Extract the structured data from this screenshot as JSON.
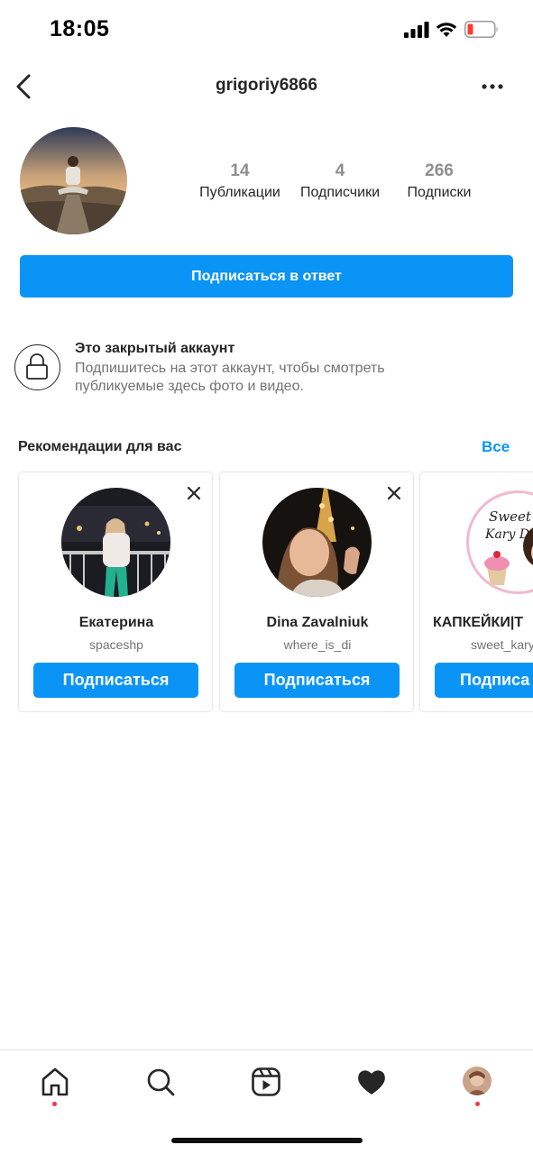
{
  "status_bar": {
    "time": "18:05"
  },
  "header": {
    "username": "grigoriy6866"
  },
  "profile": {
    "stats": [
      {
        "value": "14",
        "label": "Публикации"
      },
      {
        "value": "4",
        "label": "Подписчики"
      },
      {
        "value": "266",
        "label": "Подписки"
      }
    ],
    "follow_back_label": "Подписаться в ответ"
  },
  "private_account": {
    "title": "Это закрытый аккаунт",
    "description": "Подпишитесь на этот аккаунт, чтобы смотреть публикуемые здесь фото и видео."
  },
  "recommendations": {
    "title": "Рекомендации для вас",
    "see_all": "Все",
    "cards": [
      {
        "name": "Екатерина",
        "handle": "spaceshp",
        "button": "Подписаться"
      },
      {
        "name": "Dina Zavalniuk",
        "handle": "where_is_di",
        "button": "Подписаться"
      },
      {
        "name": "КАПКЕЙКИ|Т",
        "handle": "sweet_kary",
        "button": "Подписа",
        "logo_text": "Sweet Kary D."
      }
    ]
  },
  "nav": {
    "items": [
      "home-icon",
      "search-icon",
      "reels-icon",
      "activity-heart-icon",
      "profile-avatar"
    ],
    "accent_color": "#0a95f6",
    "notification_color": "#ff3040"
  }
}
